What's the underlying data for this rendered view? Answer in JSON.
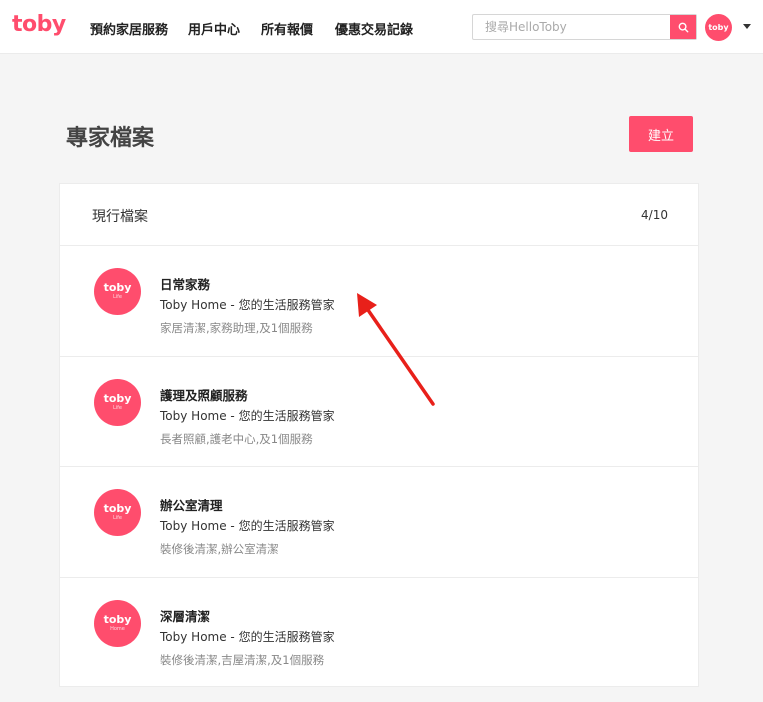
{
  "navbar": {
    "logo": "toby",
    "items": [
      {
        "label": "預約家居服務"
      },
      {
        "label": "用戶中心"
      },
      {
        "label": "所有報價"
      },
      {
        "label": "優惠交易記錄"
      }
    ],
    "search_placeholder": "搜尋HelloToby",
    "avatar_text": "toby"
  },
  "page": {
    "title": "專家檔案",
    "create_label": "建立"
  },
  "card": {
    "title": "現行檔案",
    "count": "4/10",
    "profiles": [
      {
        "name": "日常家務",
        "subtitle": "Toby Home - 您的生活服務管家",
        "services": "家居清潔,家務助理,及1個服務",
        "avatar_main": "toby",
        "avatar_sub": "Life"
      },
      {
        "name": "護理及照顧服務",
        "subtitle": "Toby Home - 您的生活服務管家",
        "services": "長者照顧,護老中心,及1個服務",
        "avatar_main": "toby",
        "avatar_sub": "Life"
      },
      {
        "name": "辦公室清理",
        "subtitle": "Toby Home - 您的生活服務管家",
        "services": "裝修後清潔,辦公室清潔",
        "avatar_main": "toby",
        "avatar_sub": "Life"
      },
      {
        "name": "深層清潔",
        "subtitle": "Toby Home - 您的生活服務管家",
        "services": "裝修後清潔,吉屋清潔,及1個服務",
        "avatar_main": "toby",
        "avatar_sub": "Home"
      }
    ]
  },
  "colors": {
    "brand": "#ff4d6d",
    "annotation_arrow": "#e8201a"
  }
}
